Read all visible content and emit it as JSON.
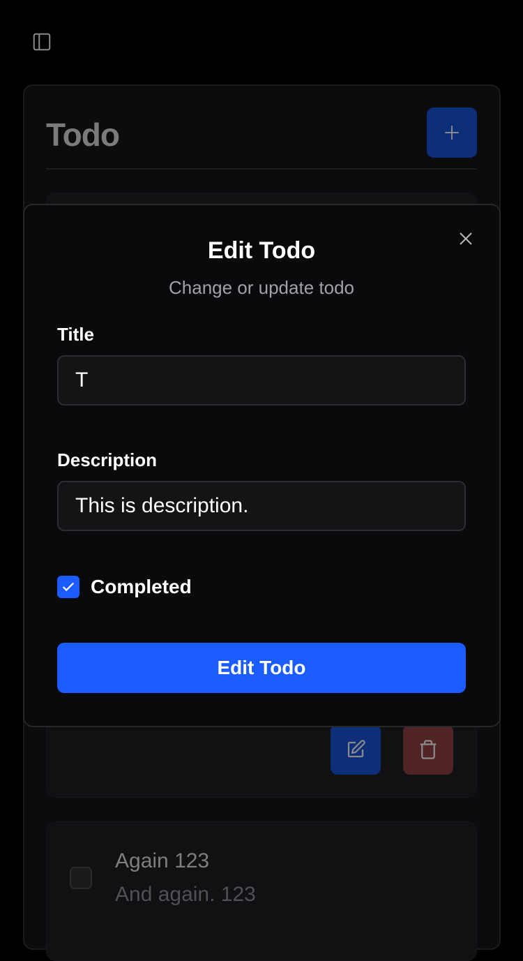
{
  "header": {
    "title": "Todo",
    "sidebar_icon": "sidebar-icon",
    "add_icon": "plus-icon"
  },
  "todos": [
    {
      "actions": {
        "edit_icon": "edit-icon",
        "delete_icon": "trash-icon"
      }
    },
    {
      "title": "Again 123",
      "description": "And again. 123",
      "completed": false
    }
  ],
  "modal": {
    "title": "Edit Todo",
    "subtitle": "Change or update todo",
    "title_label": "Title",
    "title_value": "T",
    "description_label": "Description",
    "description_value": "This is description.",
    "completed_label": "Completed",
    "completed": true,
    "submit_label": "Edit Todo",
    "close_icon": "close-icon"
  },
  "colors": {
    "accent": "#1b5cff",
    "danger": "#512526",
    "background": "#000000"
  }
}
